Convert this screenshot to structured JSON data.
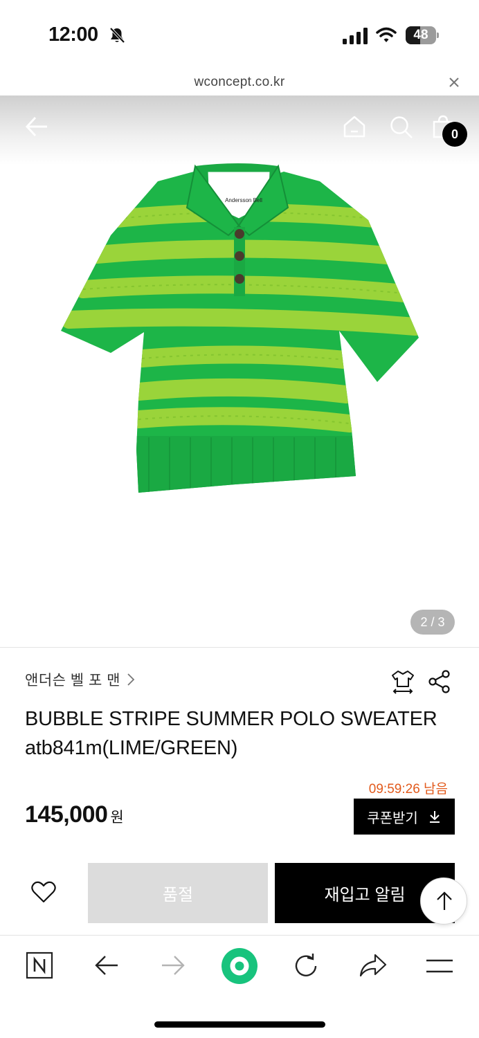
{
  "status_bar": {
    "time": "12:00",
    "battery_level": "48",
    "battery_fraction": 0.48
  },
  "browser": {
    "url": "wconcept.co.kr"
  },
  "header": {
    "cart_count": "0"
  },
  "gallery": {
    "page_indicator": "2 / 3",
    "image_label": "Andersson Bell"
  },
  "product": {
    "brand": "앤더슨 벨 포 맨",
    "title": "BUBBLE STRIPE SUMMER POLO SWEATER atb841m(LIME/GREEN)",
    "timer": "09:59:26 남음",
    "price": "145,000",
    "price_unit": "원",
    "coupon_label": "쿠폰받기"
  },
  "actions": {
    "soldout_label": "품절",
    "restock_label": "재입고 알림"
  },
  "colors": {
    "accent_green": "#18c37d",
    "timer_orange": "#e25a1c",
    "sweater_green": "#1db548",
    "sweater_lime": "#9ad43a"
  }
}
